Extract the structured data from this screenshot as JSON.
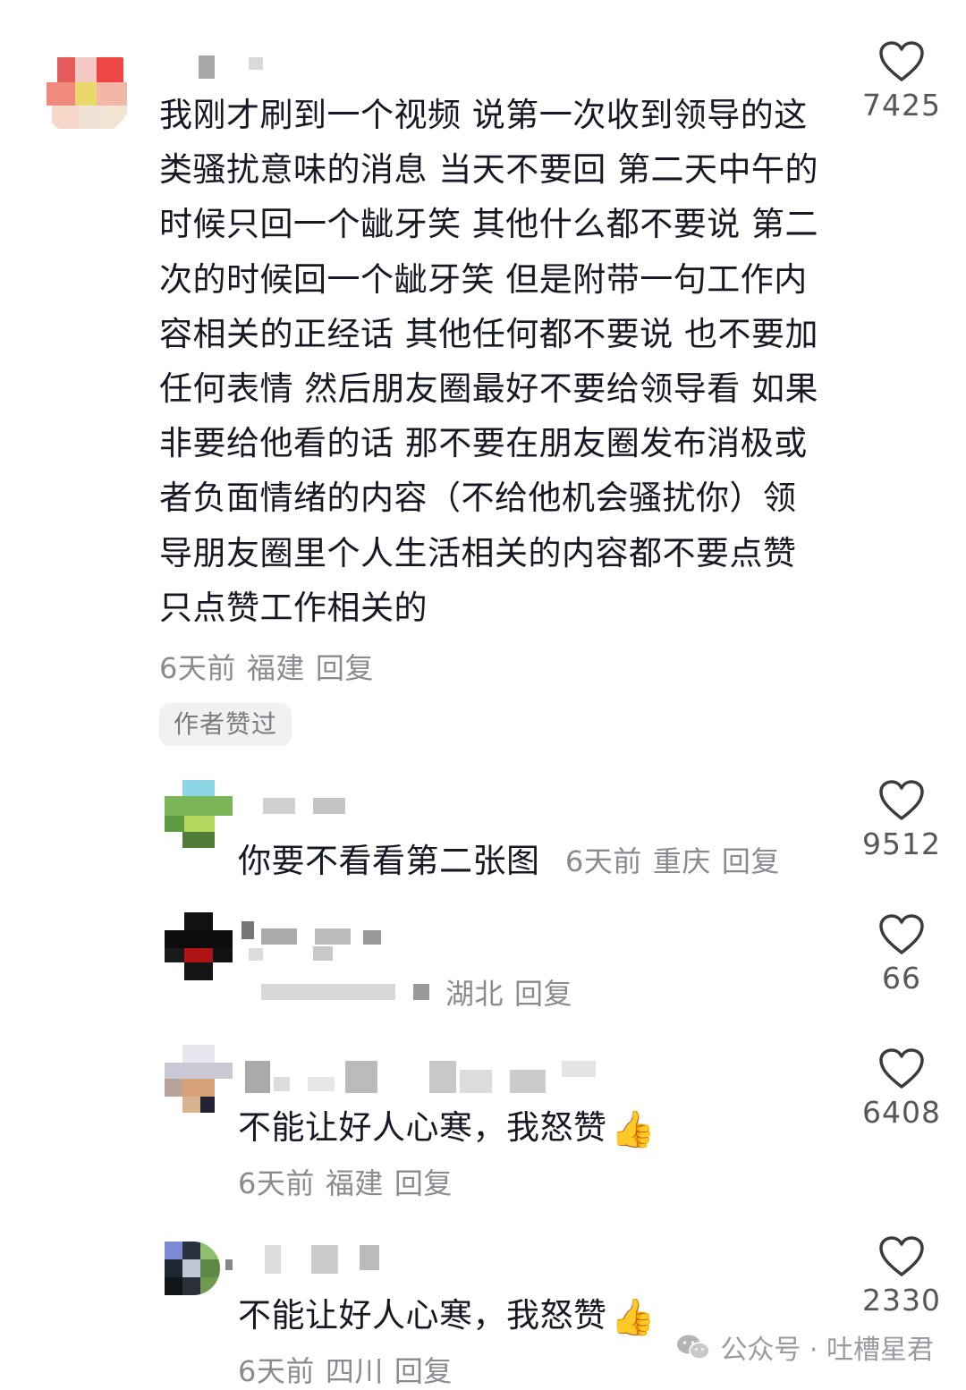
{
  "comments": [
    {
      "text": "我刚才刷到一个视频 说第一次收到领导的这类骚扰意味的消息 当天不要回 第二天中午的时候只回一个龇牙笑 其他什么都不要说 第二次的时候回一个龇牙笑 但是附带一句工作内容相关的正经话 其他任何都不要说 也不要加任何表情 然后朋友圈最好不要给领导看 如果非要给他看的话 那不要在朋友圈发布消极或者负面情绪的内容（不给他机会骚扰你）领导朋友圈里个人生活相关的内容都不要点赞 只点赞工作相关的",
      "time": "6天前",
      "location": "福建",
      "reply": "回复",
      "likes": "7425",
      "badge": "作者赞过"
    },
    {
      "text": "你要不看看第二张图",
      "time": "6天前",
      "location": "重庆",
      "reply": "回复",
      "likes": "9512"
    },
    {
      "location": "湖北",
      "reply": "回复",
      "likes": "66"
    },
    {
      "text": "不能让好人心寒，我怒赞",
      "emoji": "👍",
      "time": "6天前",
      "location": "福建",
      "reply": "回复",
      "likes": "6408"
    },
    {
      "text": "不能让好人心寒，我怒赞",
      "emoji": "👍",
      "time": "6天前",
      "location": "四川",
      "reply": "回复",
      "likes": "2330"
    }
  ],
  "watermark": {
    "text": "公众号 · 吐槽星君",
    "icon": "wechat-icon"
  },
  "colors": {
    "text": "#161823",
    "meta": "#8a8b91",
    "count": "#56575c",
    "badge_bg": "#f1f1f2"
  }
}
